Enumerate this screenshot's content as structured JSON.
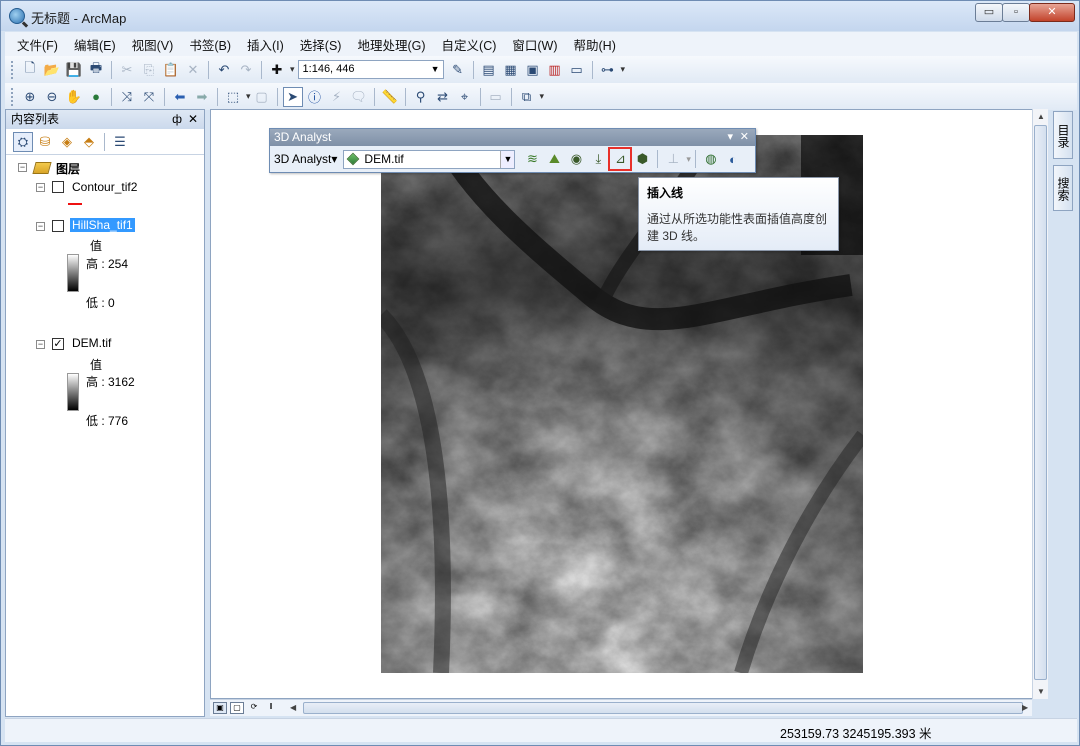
{
  "window": {
    "title": "无标题 - ArcMap",
    "min_label": "▭",
    "max_label": "▫",
    "close_label": "✕"
  },
  "menu": [
    "文件(F)",
    "编辑(E)",
    "视图(V)",
    "书签(B)",
    "插入(I)",
    "选择(S)",
    "地理处理(G)",
    "自定义(C)",
    "窗口(W)",
    "帮助(H)"
  ],
  "toolbar1": {
    "scale_value": "1:146, 446",
    "icons": [
      "new-icon",
      "open-icon",
      "save-icon",
      "print-icon",
      "cut-icon",
      "copy-icon",
      "paste-icon",
      "delete-icon",
      "undo-icon",
      "redo-icon",
      "add-data-icon"
    ]
  },
  "toc": {
    "title": "内容列表",
    "pin": "ф",
    "close": "✕",
    "root_label": "图层",
    "layers": [
      {
        "name": "Contour_tif2",
        "checked": false,
        "legend": "line"
      },
      {
        "name": "HillSha_tif1",
        "checked": false,
        "selected": true,
        "value_label": "值",
        "high": "高 : 254",
        "low": "低 : 0"
      },
      {
        "name": "DEM.tif",
        "checked": true,
        "value_label": "值",
        "high": "高 : 3162",
        "low": "低 : 776"
      }
    ]
  },
  "analyst": {
    "title": "3D Analyst",
    "menu_label": "3D Analyst",
    "layer": "DEM.tif",
    "tooltip_title": "插入线",
    "tooltip_body": "通过从所选功能性表面插值高度创建 3D 线。"
  },
  "dock": {
    "catalog": "目录",
    "search": "搜索"
  },
  "status": {
    "coordinates": "253159.73  3245195.393 米"
  }
}
